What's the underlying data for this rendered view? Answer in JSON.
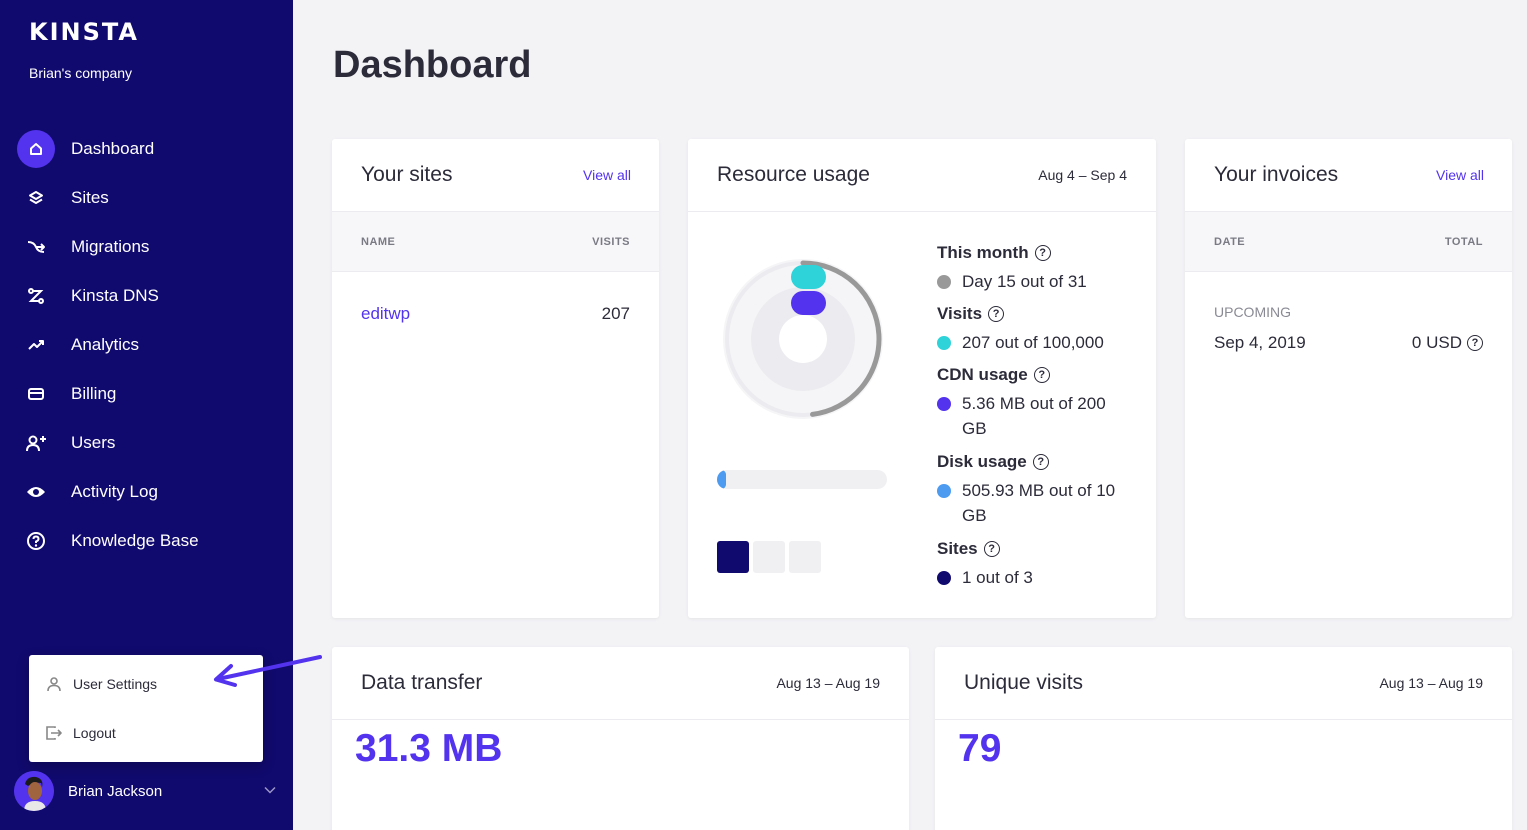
{
  "sidebar": {
    "logo": "KINSTA",
    "company": "Brian's company",
    "items": [
      {
        "label": "Dashboard",
        "icon": "home-icon"
      },
      {
        "label": "Sites",
        "icon": "layers-icon"
      },
      {
        "label": "Migrations",
        "icon": "migrations-icon"
      },
      {
        "label": "Kinsta DNS",
        "icon": "dns-icon"
      },
      {
        "label": "Analytics",
        "icon": "analytics-icon"
      },
      {
        "label": "Billing",
        "icon": "billing-icon"
      },
      {
        "label": "Users",
        "icon": "add-user-icon"
      },
      {
        "label": "Activity Log",
        "icon": "eye-icon"
      },
      {
        "label": "Knowledge Base",
        "icon": "help-icon"
      }
    ],
    "active_index": 0,
    "user_menu": {
      "settings": "User Settings",
      "logout": "Logout"
    },
    "user_name": "Brian Jackson"
  },
  "main": {
    "title": "Dashboard",
    "sites_card": {
      "title": "Your sites",
      "link": "View all",
      "col_name": "NAME",
      "col_visits": "VISITS",
      "rows": [
        {
          "name": "editwp",
          "visits": "207"
        }
      ]
    },
    "resource_card": {
      "title": "Resource usage",
      "range": "Aug 4 – Sep 4",
      "this_month_label": "This month",
      "this_month_value": "Day 15 out of 31",
      "visits_label": "Visits",
      "visits_value": "207 out of 100,000",
      "cdn_label": "CDN usage",
      "cdn_value": "5.36 MB out of 200 GB",
      "disk_label": "Disk usage",
      "disk_value": "505.93 MB out of 10 GB",
      "sites_label": "Sites",
      "sites_value": "1 out of 3",
      "month_progress": 0.48,
      "disk_progress": 0.05,
      "sites_used": 1,
      "sites_total": 3,
      "colors": {
        "month": "#999999",
        "visits": "#2ed3d9",
        "cdn": "#5333ed",
        "disk": "#4c9bf0",
        "sites": "#110a6e"
      }
    },
    "invoices_card": {
      "title": "Your invoices",
      "link": "View all",
      "col_date": "DATE",
      "col_total": "TOTAL",
      "status": "UPCOMING",
      "date": "Sep 4, 2019",
      "total": "0 USD"
    },
    "transfer_card": {
      "title": "Data transfer",
      "range": "Aug 13 – Aug 19",
      "value": "31.3 MB"
    },
    "visits_card": {
      "title": "Unique visits",
      "range": "Aug 13 – Aug 19",
      "value": "79"
    }
  }
}
